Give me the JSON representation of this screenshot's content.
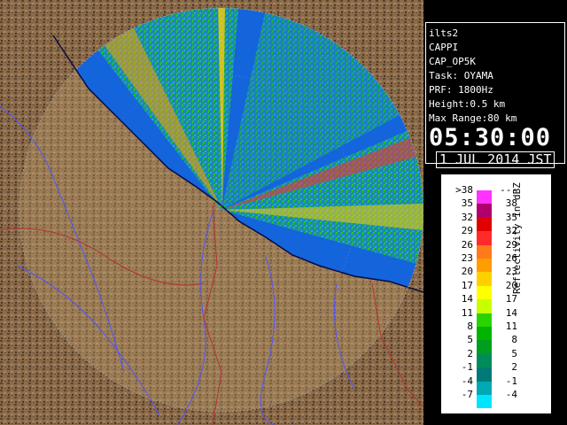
{
  "info": {
    "lines": [
      "ilts2",
      "CAPPI",
      "CAP_OP5K",
      "Task: OYAMA",
      "PRF: 1800Hz",
      "Height:0.5 km",
      "Max Range:80 km"
    ],
    "time": "05:30:00",
    "date": "1 JUL 2014 JST"
  },
  "legend": {
    "title": "Reflectivity in dBZ",
    "rows": [
      {
        "left": ">38",
        "right": "---",
        "color": "#ff33ff"
      },
      {
        "left": "35",
        "right": "38",
        "color": "#b0006e"
      },
      {
        "left": "32",
        "right": "35",
        "color": "#e00000"
      },
      {
        "left": "29",
        "right": "32",
        "color": "#ff2b2b"
      },
      {
        "left": "26",
        "right": "29",
        "color": "#ff7a1a"
      },
      {
        "left": "23",
        "right": "26",
        "color": "#ff9e00"
      },
      {
        "left": "20",
        "right": "23",
        "color": "#ffd000"
      },
      {
        "left": "17",
        "right": "20",
        "color": "#ffff00"
      },
      {
        "left": "14",
        "right": "17",
        "color": "#c8ff00"
      },
      {
        "left": "11",
        "right": "14",
        "color": "#2ad400"
      },
      {
        "left": "8",
        "right": "11",
        "color": "#00b400"
      },
      {
        "left": "5",
        "right": "8",
        "color": "#009e1e"
      },
      {
        "left": "2",
        "right": "5",
        "color": "#008c5a"
      },
      {
        "left": "-1",
        "right": "2",
        "color": "#007a78"
      },
      {
        "left": "-4",
        "right": "-1",
        "color": "#00a9b4"
      },
      {
        "left": "-7",
        "right": "-4",
        "color": "#00e5ff"
      }
    ]
  },
  "colors": {
    "sea": "#1464dc",
    "land": "#8a6a48",
    "coast": "#0a0a40",
    "river": "#5055ff",
    "border": "#b43232"
  }
}
